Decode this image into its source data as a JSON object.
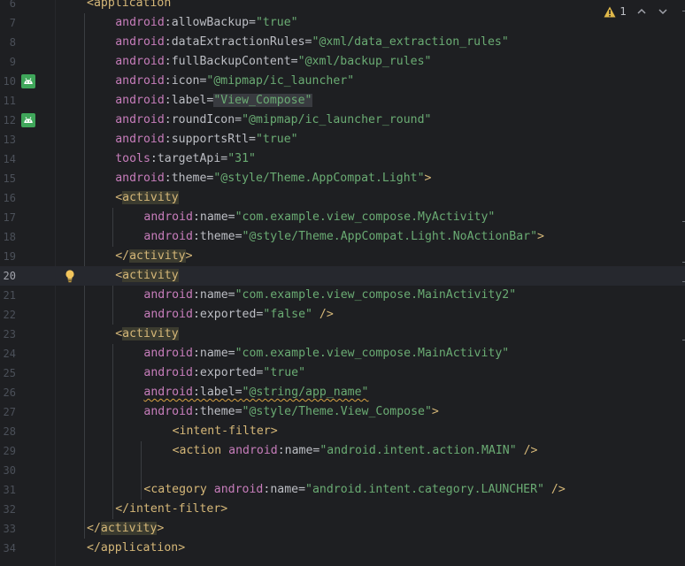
{
  "inspections": {
    "warning_count": "1"
  },
  "lines": [
    {
      "no": "6",
      "tokens": [
        {
          "t": "<application",
          "c": "brk"
        }
      ]
    },
    {
      "no": "7",
      "tokens": [
        {
          "t": "android",
          "c": "ns"
        },
        {
          "t": ":allowBackup=",
          "c": "attr"
        },
        {
          "t": "\"true\"",
          "c": "val"
        }
      ]
    },
    {
      "no": "8",
      "tokens": [
        {
          "t": "android",
          "c": "ns"
        },
        {
          "t": ":dataExtractionRules=",
          "c": "attr"
        },
        {
          "t": "\"@xml/data_extraction_rules\"",
          "c": "val"
        }
      ]
    },
    {
      "no": "9",
      "tokens": [
        {
          "t": "android",
          "c": "ns"
        },
        {
          "t": ":fullBackupContent=",
          "c": "attr"
        },
        {
          "t": "\"@xml/backup_rules\"",
          "c": "val"
        }
      ]
    },
    {
      "no": "10",
      "icon": "android-icon",
      "tokens": [
        {
          "t": "android",
          "c": "ns"
        },
        {
          "t": ":icon=",
          "c": "attr"
        },
        {
          "t": "\"@mipmap/ic_launcher\"",
          "c": "val"
        }
      ]
    },
    {
      "no": "11",
      "tokens": [
        {
          "t": "android",
          "c": "ns"
        },
        {
          "t": ":label=",
          "c": "attr"
        },
        {
          "t": "\"View_Compose\"",
          "c": "val val-hl"
        }
      ]
    },
    {
      "no": "12",
      "icon": "android-icon",
      "tokens": [
        {
          "t": "android",
          "c": "ns"
        },
        {
          "t": ":roundIcon=",
          "c": "attr"
        },
        {
          "t": "\"@mipmap/ic_launcher_round\"",
          "c": "val"
        }
      ]
    },
    {
      "no": "13",
      "tokens": [
        {
          "t": "android",
          "c": "ns"
        },
        {
          "t": ":supportsRtl=",
          "c": "attr"
        },
        {
          "t": "\"true\"",
          "c": "val"
        }
      ]
    },
    {
      "no": "14",
      "tokens": [
        {
          "t": "tools",
          "c": "ns"
        },
        {
          "t": ":targetApi=",
          "c": "attr"
        },
        {
          "t": "\"31\"",
          "c": "val"
        }
      ]
    },
    {
      "no": "15",
      "tokens": [
        {
          "t": "android",
          "c": "ns"
        },
        {
          "t": ":theme=",
          "c": "attr"
        },
        {
          "t": "\"@style/Theme.AppCompat.Light\"",
          "c": "val"
        },
        {
          "t": ">",
          "c": "brk"
        }
      ]
    },
    {
      "no": "16",
      "tokens": [
        {
          "t": "<",
          "c": "brk"
        },
        {
          "t": "activity",
          "c": "tag-hl"
        }
      ]
    },
    {
      "no": "17",
      "tokens": [
        {
          "t": "android",
          "c": "ns"
        },
        {
          "t": ":name=",
          "c": "attr"
        },
        {
          "t": "\"com.example.view_compose.MyActivity\"",
          "c": "val"
        }
      ]
    },
    {
      "no": "18",
      "tokens": [
        {
          "t": "android",
          "c": "ns"
        },
        {
          "t": ":theme=",
          "c": "attr"
        },
        {
          "t": "\"@style/Theme.AppCompat.Light.NoActionBar\"",
          "c": "val"
        },
        {
          "t": ">",
          "c": "brk"
        }
      ]
    },
    {
      "no": "19",
      "tokens": [
        {
          "t": "</",
          "c": "brk"
        },
        {
          "t": "activity",
          "c": "tag-hl"
        },
        {
          "t": ">",
          "c": "brk"
        }
      ]
    },
    {
      "no": "20",
      "current": true,
      "bulb": true,
      "tokens": [
        {
          "t": "<",
          "c": "brk"
        },
        {
          "t": "activity",
          "c": "tag-hl"
        }
      ]
    },
    {
      "no": "21",
      "tokens": [
        {
          "t": "android",
          "c": "ns"
        },
        {
          "t": ":name=",
          "c": "attr"
        },
        {
          "t": "\"com.example.view_compose.MainActivity2\"",
          "c": "val"
        }
      ]
    },
    {
      "no": "22",
      "tokens": [
        {
          "t": "android",
          "c": "ns"
        },
        {
          "t": ":exported=",
          "c": "attr"
        },
        {
          "t": "\"false\"",
          "c": "val"
        },
        {
          "t": " />",
          "c": "brk"
        }
      ]
    },
    {
      "no": "23",
      "tokens": [
        {
          "t": "<",
          "c": "brk"
        },
        {
          "t": "activity",
          "c": "tag-hl"
        }
      ]
    },
    {
      "no": "24",
      "tokens": [
        {
          "t": "android",
          "c": "ns"
        },
        {
          "t": ":name=",
          "c": "attr"
        },
        {
          "t": "\"com.example.view_compose.MainActivity\"",
          "c": "val"
        }
      ]
    },
    {
      "no": "25",
      "tokens": [
        {
          "t": "android",
          "c": "ns"
        },
        {
          "t": ":exported=",
          "c": "attr"
        },
        {
          "t": "\"true\"",
          "c": "val"
        }
      ]
    },
    {
      "no": "26",
      "tokens": [
        {
          "t": "android",
          "c": "ns squiggle"
        },
        {
          "t": ":label=",
          "c": "attr squiggle"
        },
        {
          "t": "\"@string/app_name\"",
          "c": "val squiggle"
        }
      ]
    },
    {
      "no": "27",
      "tokens": [
        {
          "t": "android",
          "c": "ns"
        },
        {
          "t": ":theme=",
          "c": "attr"
        },
        {
          "t": "\"@style/Theme.View_Compose\"",
          "c": "val"
        },
        {
          "t": ">",
          "c": "brk"
        }
      ]
    },
    {
      "no": "28",
      "tokens": [
        {
          "t": "<intent-filter>",
          "c": "brk"
        }
      ]
    },
    {
      "no": "29",
      "tokens": [
        {
          "t": "<action ",
          "c": "brk"
        },
        {
          "t": "android",
          "c": "ns"
        },
        {
          "t": ":name=",
          "c": "attr"
        },
        {
          "t": "\"android.intent.action.MAIN\"",
          "c": "val"
        },
        {
          "t": " />",
          "c": "brk"
        }
      ]
    },
    {
      "no": "30",
      "tokens": []
    },
    {
      "no": "31",
      "tokens": [
        {
          "t": "<category ",
          "c": "brk"
        },
        {
          "t": "android",
          "c": "ns"
        },
        {
          "t": ":name=",
          "c": "attr"
        },
        {
          "t": "\"android.intent.category.LAUNCHER\"",
          "c": "val"
        },
        {
          "t": " />",
          "c": "brk"
        }
      ]
    },
    {
      "no": "32",
      "tokens": [
        {
          "t": "</intent-filter>",
          "c": "brk"
        }
      ]
    },
    {
      "no": "33",
      "tokens": [
        {
          "t": "</",
          "c": "brk"
        },
        {
          "t": "activity",
          "c": "tag-hl"
        },
        {
          "t": ">",
          "c": "brk"
        }
      ]
    },
    {
      "no": "34",
      "tokens": [
        {
          "t": "</application>",
          "c": "brk"
        }
      ]
    }
  ]
}
